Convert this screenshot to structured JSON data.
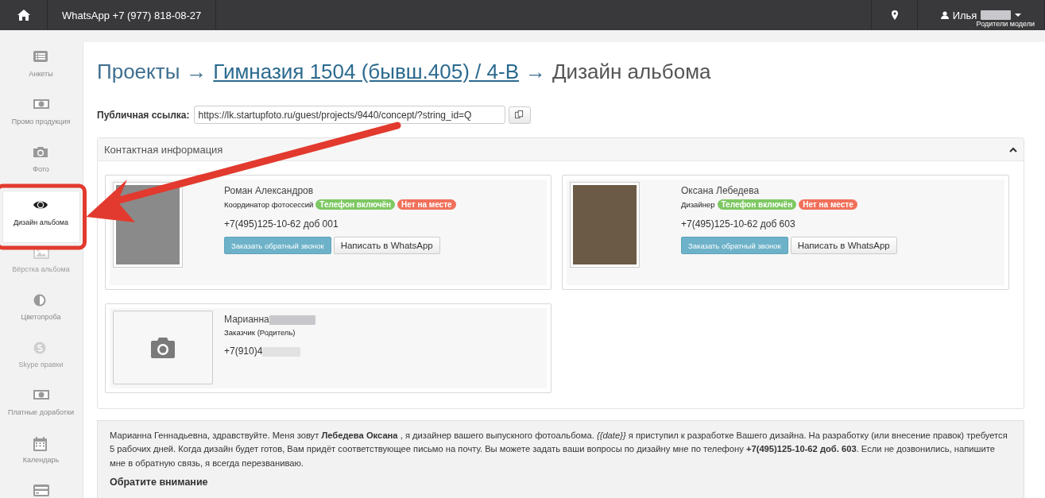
{
  "topbar": {
    "phone": "WhatsApp +7 (977) 818-08-27",
    "user": {
      "name": "Илья",
      "role": "Родители модели"
    }
  },
  "sidebar": {
    "items": [
      {
        "label": "Анкеты",
        "selected": false,
        "disabled": false
      },
      {
        "label": "Промо продукция",
        "selected": false,
        "disabled": false
      },
      {
        "label": "Фото",
        "selected": false,
        "disabled": false
      },
      {
        "label": "Дизайн альбома",
        "selected": true,
        "disabled": false
      },
      {
        "label": "Вёрстка альбома",
        "selected": false,
        "disabled": true
      },
      {
        "label": "Цветопроба",
        "selected": false,
        "disabled": false
      },
      {
        "label": "Skype правки",
        "selected": false,
        "disabled": true
      },
      {
        "label": "Платные доработки",
        "selected": false,
        "disabled": false
      },
      {
        "label": "Календарь",
        "selected": false,
        "disabled": false
      },
      {
        "selected": false,
        "disabled": false
      }
    ]
  },
  "breadcrumbs": [
    {
      "text": "Проекты",
      "link": false
    },
    {
      "text": "Гимназия 1504 (бывш.405) / 4-В",
      "link": true
    },
    {
      "text": "Дизайн альбома",
      "link": false
    }
  ],
  "breadcrumb_separator": "→",
  "public_link": {
    "label": "Публичная ссылка:",
    "value": "https://lk.startupfoto.ru/guest/projects/9440/concept/?string_id=Q"
  },
  "contacts": {
    "title": "Контактная информация",
    "expanded": true,
    "cards": [
      {
        "name": "Роман Александров",
        "name_redacted": false,
        "role": "Координатор фотосессий",
        "photo": true,
        "badges": [
          {
            "text": "Телефон включён",
            "color": "#7dc862"
          },
          {
            "text": "Нет на месте",
            "color": "#f0705a"
          }
        ],
        "phone": "+7(495)125-10-62 доб 001",
        "phone_redacted": false,
        "buttons": [
          {
            "label": "Заказать обратный звонок",
            "kind": "primary"
          },
          {
            "label": "Написать в WhatsApp",
            "kind": "default"
          }
        ]
      },
      {
        "name": "Оксана Лебедева",
        "name_redacted": false,
        "role": "Дизайнер",
        "photo": true,
        "badges": [
          {
            "text": "Телефон включён",
            "color": "#7dc862"
          },
          {
            "text": "Нет на месте",
            "color": "#f0705a"
          }
        ],
        "phone": "+7(495)125-10-62 доб 603",
        "phone_redacted": false,
        "buttons": [
          {
            "label": "Заказать обратный звонок",
            "kind": "primary"
          },
          {
            "label": "Написать в WhatsApp",
            "kind": "default"
          }
        ]
      },
      {
        "name": "Марианна",
        "name_redacted": true,
        "role": "Заказчик (Родитель)",
        "photo": false,
        "phone": "+7(910)4",
        "phone_redacted": true
      }
    ]
  },
  "message": {
    "text": "Марианна Геннадьевна, здравствуйте. Меня зовут **Лебедева Оксана** , я дизайнер вашего выпускного фотоальбома. *{{date}}* я приступил к разработке Вашего дизайна. На разработку (или внесение правок) требуется 5 рабочих дней. Когда дизайн будет готов, Вам придёт соответствующее письмо на почту. Вы можете задать ваши вопросы по дизайну мне по телефону **+7(495)125-10-62 доб. 603**. Если не дозвонились, напишите мне в обратную связь, я всегда перезваниваю.",
    "heading": "Обратите внимание"
  }
}
